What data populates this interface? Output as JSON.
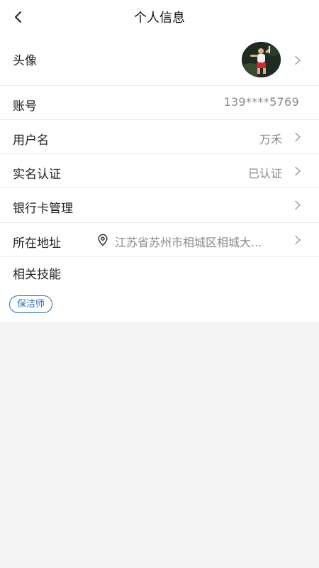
{
  "header": {
    "title": "个人信息"
  },
  "rows": {
    "avatar": {
      "label": "头像"
    },
    "account": {
      "label": "账号",
      "value": "139****5769"
    },
    "username": {
      "label": "用户名",
      "value": "万禾"
    },
    "realname": {
      "label": "实名认证",
      "value": "已认证"
    },
    "bank": {
      "label": "银行卡管理"
    },
    "address": {
      "label": "所在地址",
      "value": "江苏省苏州市相城区相城大..."
    }
  },
  "skills": {
    "label": "相关技能",
    "tags": [
      "保洁师"
    ]
  },
  "icons": {
    "back": "chevron-left-icon",
    "chevron": "chevron-right-icon",
    "location": "location-pin-icon"
  },
  "colors": {
    "accent": "#2f6fb3",
    "muted_text": "#8a8a8a",
    "background": "#f4f4f4"
  }
}
